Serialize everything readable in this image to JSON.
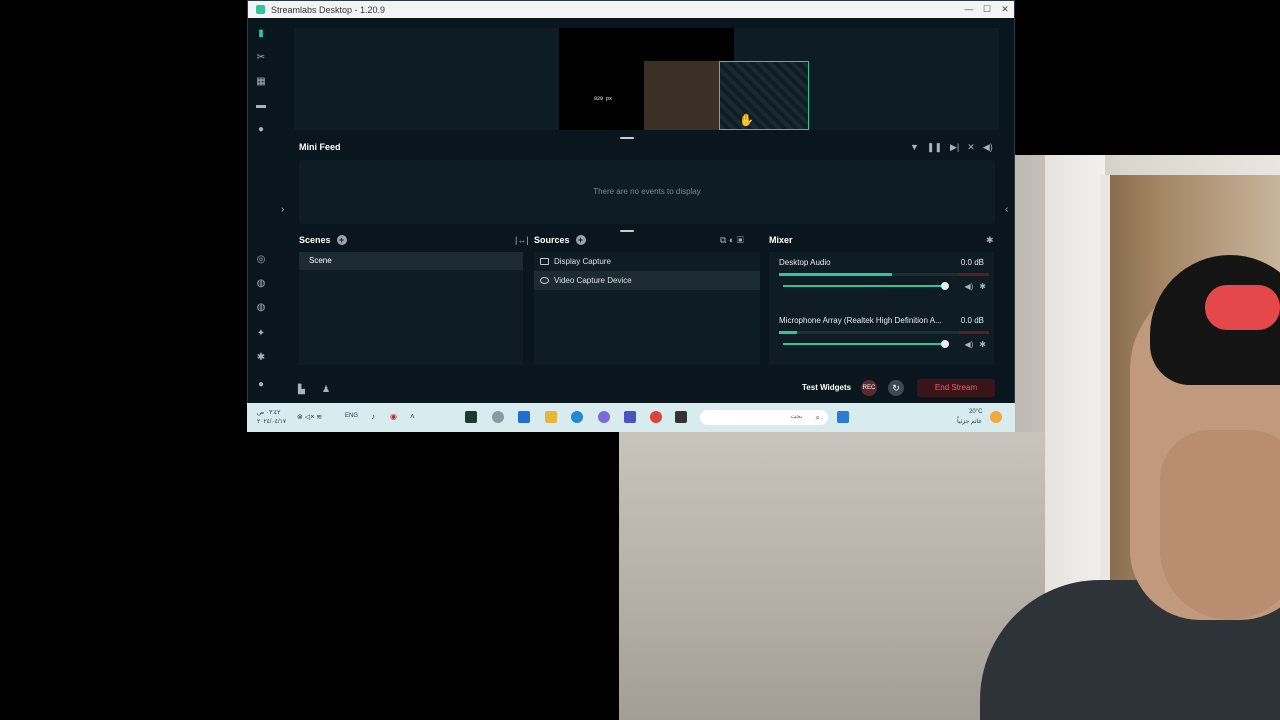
{
  "window": {
    "title": "Streamlabs Desktop - 1.20.9",
    "controls": [
      "—",
      "☐",
      "✕"
    ]
  },
  "preview": {
    "size_label": "929 px"
  },
  "minifeed": {
    "title": "Mini Feed",
    "empty_text": "There are no events to display"
  },
  "scenes": {
    "title": "Scenes",
    "items": [
      "Scene"
    ]
  },
  "sources": {
    "title": "Sources",
    "items": [
      "Display Capture",
      "Video Capture Device"
    ]
  },
  "mixer": {
    "title": "Mixer",
    "channels": [
      {
        "name": "Desktop Audio",
        "db": "0.0 dB",
        "level": 0.55
      },
      {
        "name": "Microphone Array (Realtek High Definition A...",
        "db": "0.0 dB",
        "level": 0.09
      }
    ]
  },
  "footer": {
    "test_widgets": "Test Widgets",
    "end_stream": "End Stream",
    "rec_label": "REC"
  },
  "taskbar": {
    "left_time": "٠٣:٤٢ ص",
    "left_date": "٢٠٢٤/٠٤/١٧",
    "lang": "ENG",
    "search_placeholder": "بحث",
    "weather_temp": "20°C",
    "weather_text": "غائم جزئياً"
  },
  "colors": {
    "accent": "#31c3a2",
    "bg": "#09161d",
    "panel": "#0e1c24",
    "danger": "#ff5a66"
  }
}
